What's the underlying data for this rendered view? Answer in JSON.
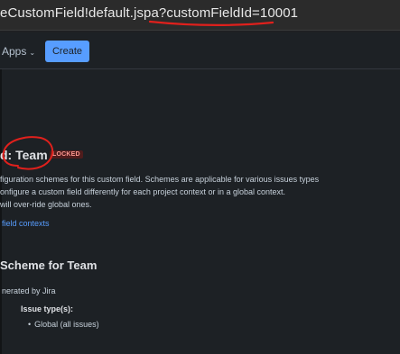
{
  "browser": {
    "url_text": "eCustomField!default.jspa?customFieldId=10001"
  },
  "topnav": {
    "apps_label": "Apps",
    "create_label": "Create"
  },
  "page": {
    "title": "d: Team",
    "badge": "LOCKED",
    "description_lines": [
      "figuration schemes for this custom field. Schemes are applicable for various issues types",
      "onfigure a custom field differently for each project context or in a global context.",
      "will over-ride global ones."
    ],
    "link_text": "field contexts",
    "scheme_title": "Scheme for Team",
    "generated_by": "nerated by Jira",
    "issue_types_label": "Issue type(s):",
    "issue_types": [
      "Global (all issues)"
    ]
  },
  "colors": {
    "annotation": "#e0201c",
    "accent": "#579dff"
  },
  "icons": {
    "apps_chevron": "chevron-down-icon"
  }
}
